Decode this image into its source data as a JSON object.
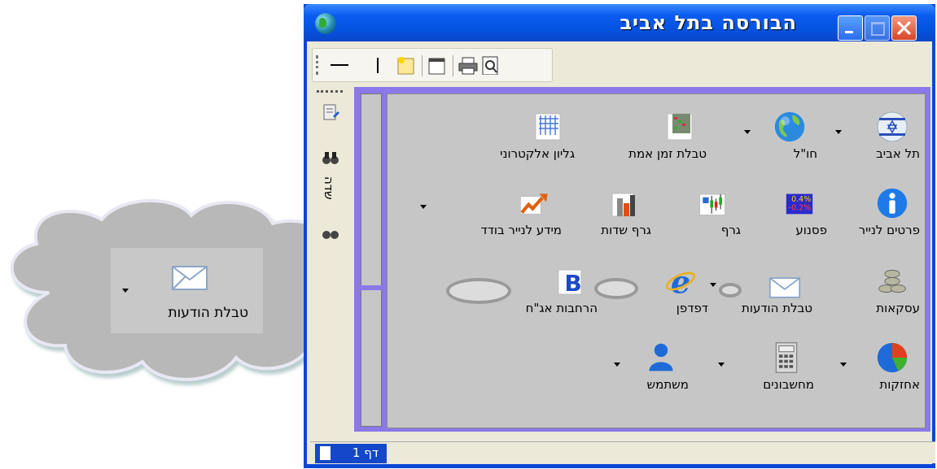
{
  "window": {
    "title": "הבורסה בתל אביב"
  },
  "left_strip": {
    "label": "שדה"
  },
  "panel": {
    "items": [
      {
        "id": "tel-aviv",
        "label": "תל אביב",
        "icon": "israel-flag-icon",
        "has_dropdown": true
      },
      {
        "id": "abroad",
        "label": "חו\"ל",
        "icon": "globe-icon",
        "has_dropdown": true
      },
      {
        "id": "realtime-table",
        "label": "טבלת זמן אמת",
        "icon": "table-grid-icon",
        "has_dropdown": false
      },
      {
        "id": "spreadsheet",
        "label": "גליון אלקטרוני",
        "icon": "spreadsheet-icon",
        "has_dropdown": false
      },
      {
        "id": "security-details",
        "label": "פרטים לנייר",
        "icon": "info-icon",
        "has_dropdown": false
      },
      {
        "id": "ticker",
        "label": "פסנוע",
        "icon": "ticker-icon",
        "has_dropdown": false
      },
      {
        "id": "graph",
        "label": "גרף",
        "icon": "candlestick-chart-icon",
        "has_dropdown": false
      },
      {
        "id": "fields-graph",
        "label": "גרף שדות",
        "icon": "bar-chart-icon",
        "has_dropdown": false
      },
      {
        "id": "security-info",
        "label": "מידע לנייר בודד",
        "icon": "trend-arrow-icon",
        "has_dropdown": true
      },
      {
        "id": "transactions",
        "label": "עסקאות",
        "icon": "coins-icon",
        "has_dropdown": false
      },
      {
        "id": "messages-table",
        "label": "טבלת הודעות",
        "icon": "envelope-icon",
        "has_dropdown": true
      },
      {
        "id": "browser",
        "label": "דפדפן",
        "icon": "browser-e-icon",
        "has_dropdown": false
      },
      {
        "id": "bond-expansions",
        "label": "הרחבות אג\"ח",
        "icon": "b-document-icon",
        "has_dropdown": false
      },
      {
        "id": "holdings",
        "label": "אחזקות",
        "icon": "pie-chart-icon",
        "has_dropdown": true
      },
      {
        "id": "calculations",
        "label": "מחשבונים",
        "icon": "calculator-icon",
        "has_dropdown": true
      },
      {
        "id": "user",
        "label": "משתמש",
        "icon": "user-icon",
        "has_dropdown": true
      }
    ],
    "ticker_values": {
      "up": "0.4%",
      "down": "-0.2%"
    }
  },
  "status": {
    "page_tab": "דף 1"
  },
  "callout": {
    "label": "טבלת הודעות",
    "icon": "envelope-icon"
  },
  "colors": {
    "titlebar": "#0a5cf0",
    "frame": "#8b78ea",
    "panel": "#c6c6c6"
  }
}
